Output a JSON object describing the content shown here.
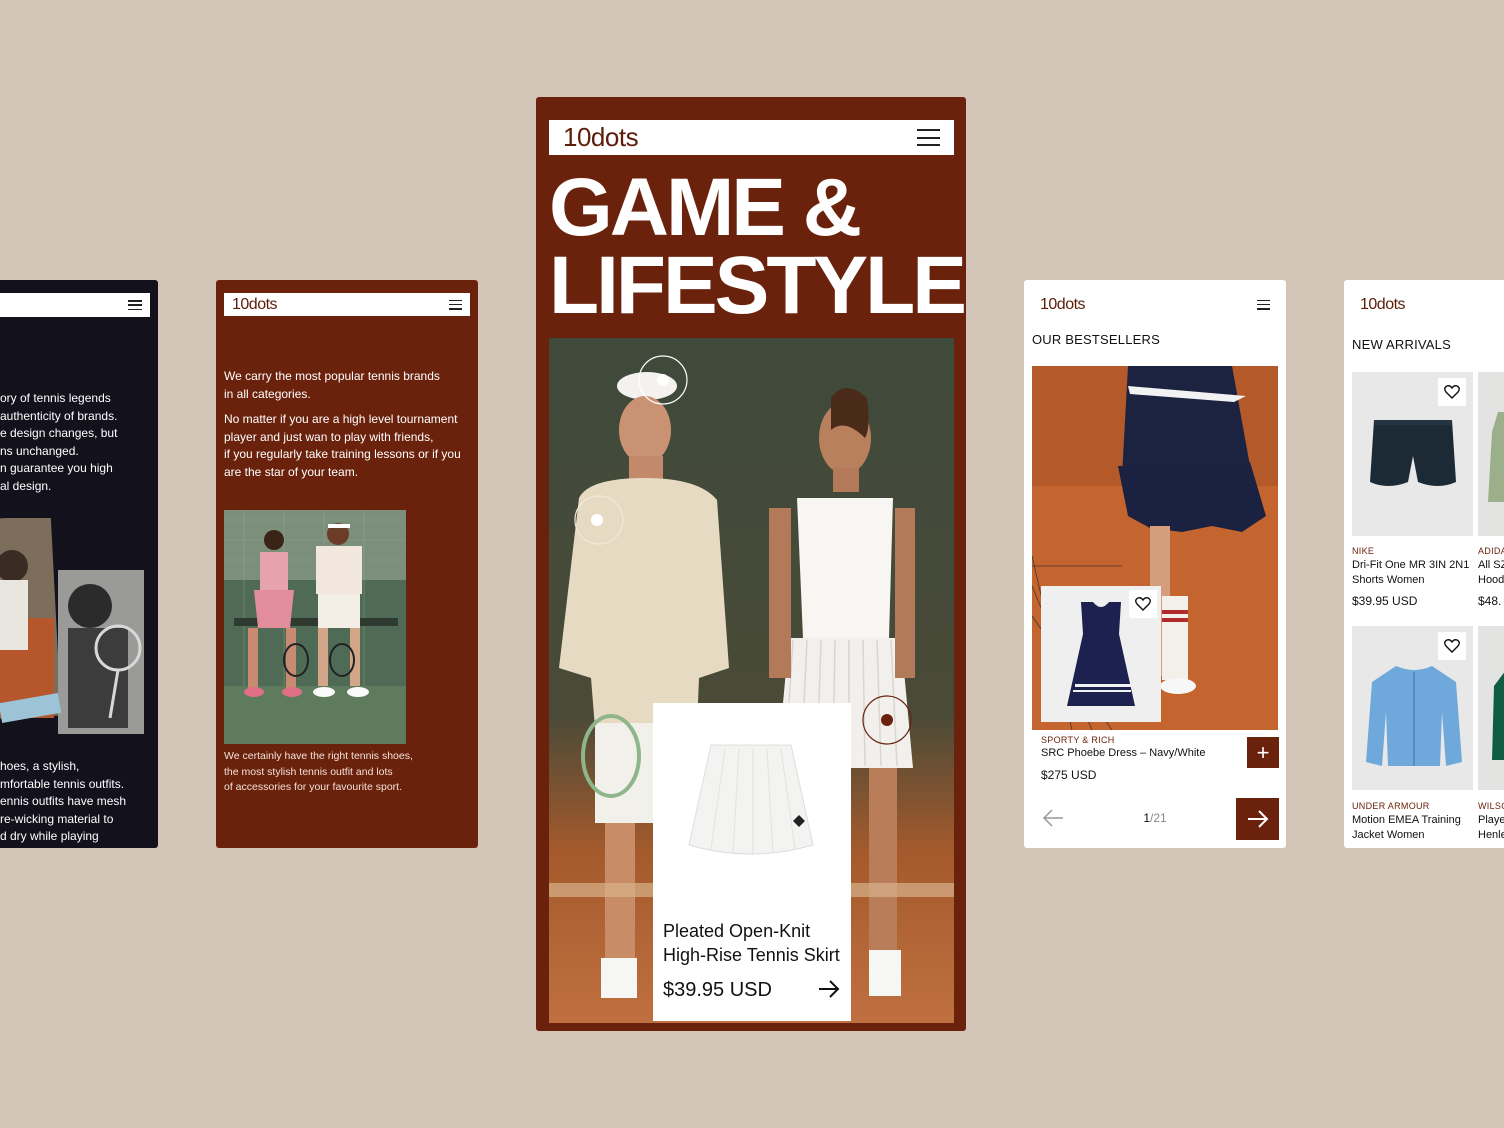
{
  "screen1": {
    "paragraph1": [
      "ory of tennis legends",
      "authenticity of brands.",
      "e design changes, but",
      "ns unchanged.",
      "n guarantee you high",
      "al design."
    ],
    "paragraph2": [
      "hoes, a stylish,",
      "mfortable tennis outfits.",
      "ennis outfits have mesh",
      "re-wicking material to",
      "d dry while playing"
    ]
  },
  "screen2": {
    "logo": "10dots",
    "paragraph1": [
      "We carry the most popular tennis brands",
      "in all categories."
    ],
    "paragraph2": [
      "No matter if you are a high level tournament",
      "player and just wan to play with friends,",
      "if you regularly take training lessons or if you",
      "are the star of your team."
    ],
    "caption": [
      "We certainly have the right tennis shoes,",
      "the most stylish tennis outfit and lots",
      "of accessories for your favourite sport."
    ]
  },
  "screen3": {
    "logo": "10dots",
    "hero_line1": "GAME &",
    "hero_line2": "LIFESTYLE",
    "product": {
      "name_line1": "Pleated Open-Knit",
      "name_line2": "High-Rise Tennis Skirt",
      "price": "$39.95 USD"
    }
  },
  "screen4": {
    "logo": "10dots",
    "section_title": "OUR BESTSELLERS",
    "product": {
      "brand": "SPORTY & RICH",
      "name": "SRC Phoebe Dress – Navy/White",
      "price": "$275 USD"
    },
    "add_label": "+",
    "pager_current": "1",
    "pager_total": "/21"
  },
  "screen5": {
    "logo": "10dots",
    "section_title": "NEW ARRIVALS",
    "products": [
      {
        "brand": "NIKE",
        "name_line1": "Dri-Fit One MR 3IN 2N1",
        "name_line2": "Shorts Women",
        "price": "$39.95 USD"
      },
      {
        "brand": "ADIDA",
        "name_line1": "All SZ",
        "name_line2": "Hood",
        "price": "$48."
      },
      {
        "brand": "UNDER ARMOUR",
        "name_line1": "Motion EMEA Training",
        "name_line2": "Jacket Women"
      },
      {
        "brand": "WILSO",
        "name_line1": "Playe",
        "name_line2": "Henle"
      }
    ]
  },
  "colors": {
    "background": "#d3c5b8",
    "brand": "#6a220c",
    "dark_screen": "#12111c"
  }
}
